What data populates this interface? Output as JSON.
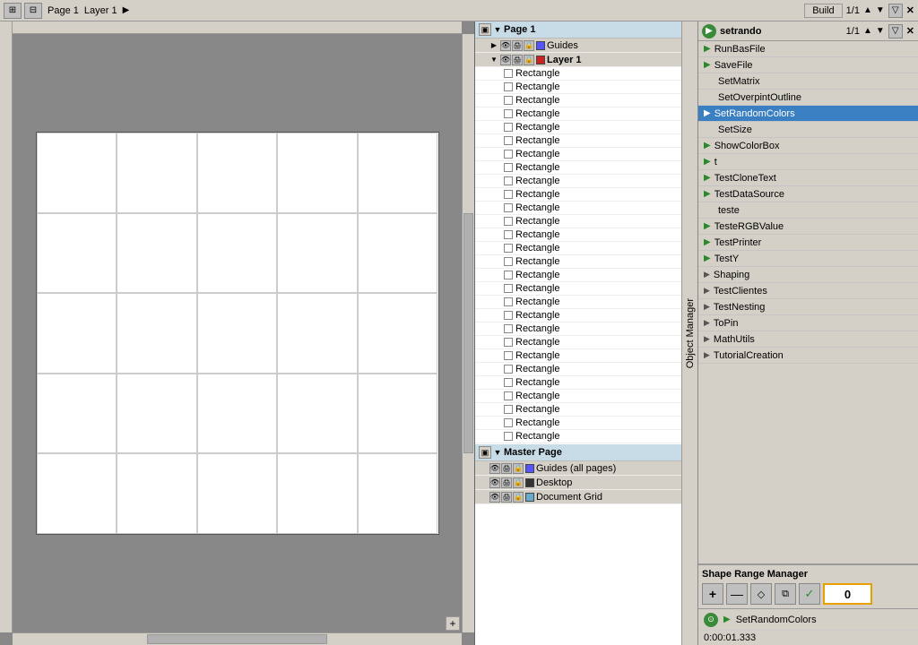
{
  "topbar": {
    "icons": [
      "⊞",
      "⊟",
      "⊕"
    ],
    "page_label": "Page 1",
    "layer_label": "Layer 1",
    "nav_arrow": "▶",
    "build_label": "Build",
    "page_count": "1/1",
    "up_arrow": "▲",
    "down_arrow": "▼",
    "filter_icon": "▽",
    "close_icon": "✕"
  },
  "layers": {
    "page1": {
      "label": "Page 1",
      "children": [
        {
          "label": "Guides",
          "color": "#5555ff",
          "indent": 1
        },
        {
          "label": "Layer 1",
          "color": "#cc2222",
          "indent": 1,
          "selected": false
        }
      ]
    },
    "rectangles": [
      "Rectangle",
      "Rectangle",
      "Rectangle",
      "Rectangle",
      "Rectangle",
      "Rectangle",
      "Rectangle",
      "Rectangle",
      "Rectangle",
      "Rectangle",
      "Rectangle",
      "Rectangle",
      "Rectangle",
      "Rectangle",
      "Rectangle",
      "Rectangle",
      "Rectangle",
      "Rectangle",
      "Rectangle",
      "Rectangle",
      "Rectangle",
      "Rectangle",
      "Rectangle",
      "Rectangle",
      "Rectangle",
      "Rectangle",
      "Rectangle",
      "Rectangle"
    ],
    "masterPage": {
      "label": "Master Page",
      "children": [
        {
          "label": "Guides (all pages)",
          "color": "#5555ff"
        },
        {
          "label": "Desktop",
          "color": "#333333"
        },
        {
          "label": "Document Grid",
          "color": "#66aacc"
        }
      ]
    }
  },
  "script_panel": {
    "label": "setrando",
    "page_info": "1/1",
    "items": [
      {
        "name": "RunBasFile",
        "has_play": true
      },
      {
        "name": "SaveFile",
        "has_play": true
      },
      {
        "name": "SetMatrix",
        "has_play": false
      },
      {
        "name": "SetOverpintOutline",
        "has_play": false
      },
      {
        "name": "SetRandomColors",
        "has_play": true,
        "selected": true
      },
      {
        "name": "SetSize",
        "has_play": false
      },
      {
        "name": "ShowColorBox",
        "has_play": true
      },
      {
        "name": "t",
        "has_play": true
      },
      {
        "name": "TestCloneText",
        "has_play": true
      },
      {
        "name": "TestDataSource",
        "has_play": true
      },
      {
        "name": "teste",
        "has_play": false
      },
      {
        "name": "TesteRGBValue",
        "has_play": true
      },
      {
        "name": "TestPrinter",
        "has_play": true
      },
      {
        "name": "TestY",
        "has_play": true
      }
    ],
    "groups": [
      {
        "name": "Shaping"
      },
      {
        "name": "TestClientes"
      },
      {
        "name": "TestNesting"
      },
      {
        "name": "ToPin"
      },
      {
        "name": "MathUtils"
      },
      {
        "name": "TutorialCreation"
      }
    ],
    "shape_range": {
      "title": "Shape Range Manager",
      "tools": [
        "+",
        "—",
        "◇",
        "⧉"
      ],
      "check": "✓",
      "value": "0"
    },
    "status": {
      "func_name": "SetRandomColors",
      "time": "0:00:01.333"
    }
  },
  "object_manager_tab": "Object Manager"
}
